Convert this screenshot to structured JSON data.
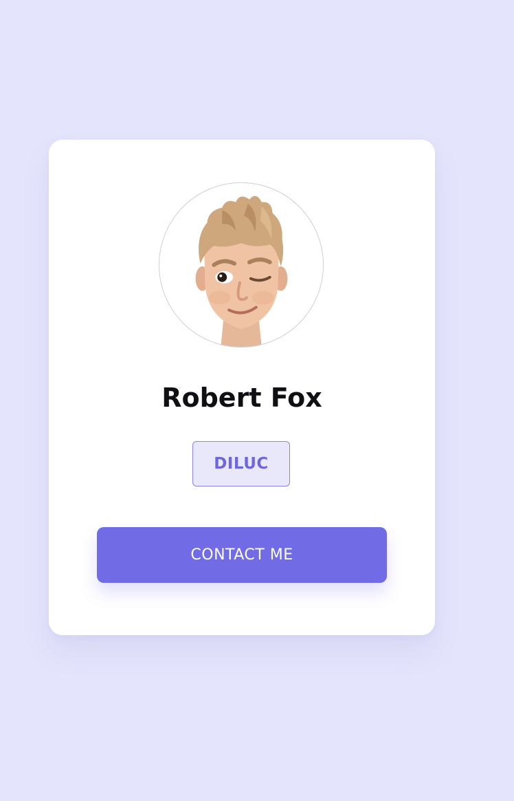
{
  "profile": {
    "avatar_icon": "memoji-avatar-icon",
    "name": "Robert Fox",
    "tag_label": "DILUC",
    "contact_label": "CONTACT ME"
  },
  "colors": {
    "background": "#e4e4fc",
    "card": "#ffffff",
    "accent": "#716ce6",
    "tag_text": "#6d66dc",
    "tag_bg": "#e9e8fb",
    "name_text": "#0f0f14"
  }
}
